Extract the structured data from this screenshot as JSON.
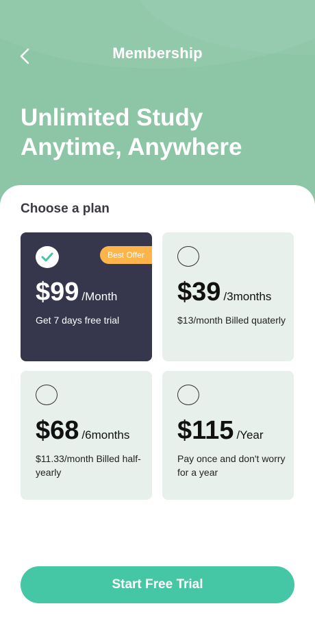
{
  "header": {
    "title": "Membership",
    "back_icon": "chevron-left-icon"
  },
  "hero": {
    "headline_line1": "Unlimited Study",
    "headline_line2": "Anytime, Anywhere"
  },
  "section": {
    "label": "Choose a plan"
  },
  "plans": [
    {
      "price": "$99",
      "period": "/Month",
      "description": "Get 7 days free trial",
      "badge": "Best Offer",
      "selected": true
    },
    {
      "price": "$39",
      "period": "/3months",
      "description": "$13/month Billed quaterly",
      "selected": false
    },
    {
      "price": "$68",
      "period": "/6months",
      "description": "$11.33/month Billed half-yearly",
      "selected": false
    },
    {
      "price": "$115",
      "period": "/Year",
      "description": "Pay once and don't worry for a year",
      "selected": false
    }
  ],
  "cta": {
    "label": "Start Free Trial"
  },
  "colors": {
    "hero_bg": "#8cc6a6",
    "selected_card": "#36364c",
    "card_bg": "#e7f0ea",
    "badge": "#fdb44b",
    "cta": "#45c6a4",
    "checkmark": "#45c6a4"
  }
}
